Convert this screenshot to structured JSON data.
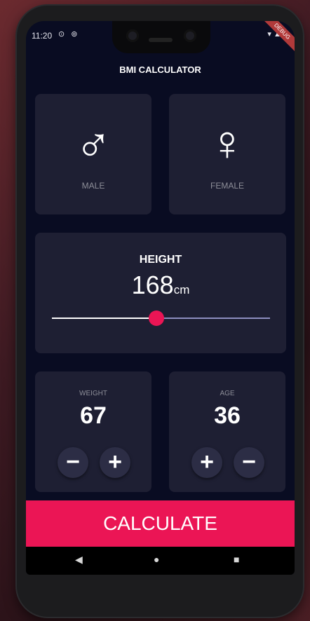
{
  "status_bar": {
    "time": "11:20",
    "left_icons": "⊙ ⊚",
    "right_icons": "▾ ▲ ▮"
  },
  "debug_banner": "DEBUG",
  "app_title": "BMI CALCULATOR",
  "gender": {
    "male": {
      "symbol": "♂",
      "label": "MALE",
      "icon": "male-symbol-icon"
    },
    "female": {
      "symbol": "♀",
      "label": "FEMALE",
      "icon": "female-symbol-icon"
    }
  },
  "height": {
    "title": "HEIGHT",
    "value": "168",
    "unit": "cm",
    "slider_fraction": 0.48,
    "colors": {
      "active": "#ffffff",
      "inactive": "#8d8ec0",
      "thumb": "#eb1555"
    }
  },
  "weight": {
    "label": "WEIGHT",
    "value": "67",
    "minus": "−",
    "plus": "+"
  },
  "age": {
    "label": "AGE",
    "value": "36",
    "plus": "+",
    "minus": "−"
  },
  "calculate_button": "CALCULATE",
  "nav": {
    "back": "◀",
    "home": "●",
    "recent": "■"
  },
  "colors": {
    "background": "#090c22",
    "card": "#1e1f33",
    "accent": "#eb1555",
    "label": "#8d8e98",
    "button": "#2c2d45"
  }
}
